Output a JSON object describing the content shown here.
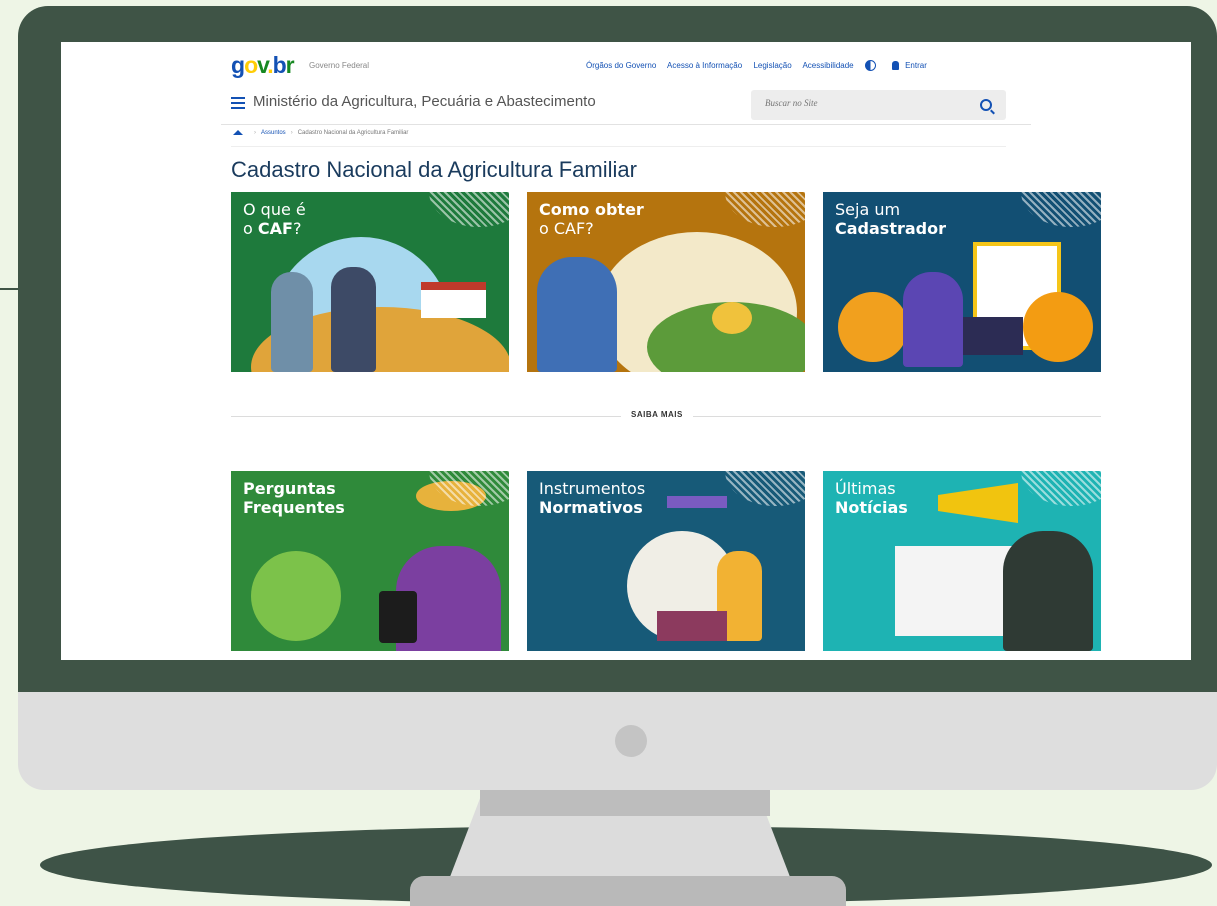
{
  "header": {
    "logo_parts": [
      "g",
      "o",
      "v",
      ".",
      "b",
      "r"
    ],
    "gov_label": "Governo Federal",
    "links": [
      "Órgãos do Governo",
      "Acesso à Informação",
      "Legislação",
      "Acessibilidade"
    ],
    "login_label": "Entrar"
  },
  "ministry": {
    "name": "Ministério da Agricultura, Pecuária e Abastecimento",
    "search_placeholder": "Buscar no Site"
  },
  "breadcrumb": {
    "items": [
      "Assuntos",
      "Cadastro Nacional da Agricultura Familiar"
    ]
  },
  "page_title": "Cadastro Nacional da Agricultura Familiar",
  "divider_label": "SAIBA MAIS",
  "cards_top": [
    {
      "line1": "O que é",
      "line2_prefix": "o ",
      "line2_bold": "CAF",
      "line2_suffix": "?",
      "color": "#1e7a3c"
    },
    {
      "line1": "Como obter",
      "line2_prefix": "o CAF?",
      "line2_bold": "",
      "line2_suffix": "",
      "color": "#b5740e"
    },
    {
      "line1": "Seja um",
      "line2_prefix": "",
      "line2_bold": "Cadastrador",
      "line2_suffix": "",
      "color": "#124f73"
    }
  ],
  "cards_bottom": [
    {
      "line1": "Perguntas",
      "line2": "Frequentes",
      "color": "#2f8a3a"
    },
    {
      "line1": "Instrumentos",
      "line2": "Normativos",
      "color": "#175a78"
    },
    {
      "line1": "Últimas",
      "line2": "Notícias",
      "color": "#1eb3b3"
    }
  ],
  "colors": {
    "bezel": "#3f5446",
    "background": "#eef5e6",
    "gov_blue": "#1351b4",
    "title": "#1a3b5d"
  }
}
